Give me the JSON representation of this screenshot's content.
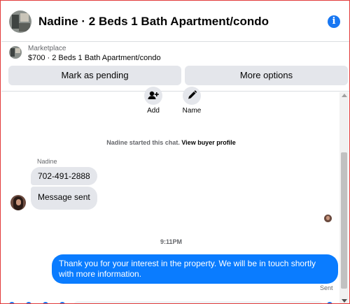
{
  "header": {
    "title": "Nadine · 2 Beds 1 Bath Apartment/condo",
    "info_icon": "i"
  },
  "listing": {
    "label": "Marketplace",
    "description": "$700 · 2 Beds 1 Bath Apartment/condo",
    "pending_label": "Mark as pending",
    "more_label": "More options"
  },
  "actions": {
    "add_label": "Add",
    "name_label": "Name"
  },
  "chat": {
    "started_text": "Nadine started this chat.",
    "profile_link": "View buyer profile",
    "sender_name": "Nadine",
    "incoming": [
      "702-491-2888",
      "Message sent"
    ],
    "timestamp": "9:11PM",
    "outgoing": "Thank you for your interest in the property. We will be in touch shortly with more information.",
    "status": "Sent"
  },
  "colors": {
    "accent": "#0a7cff",
    "bubble_in": "#e4e6eb",
    "button_bg": "#e4e6eb"
  }
}
